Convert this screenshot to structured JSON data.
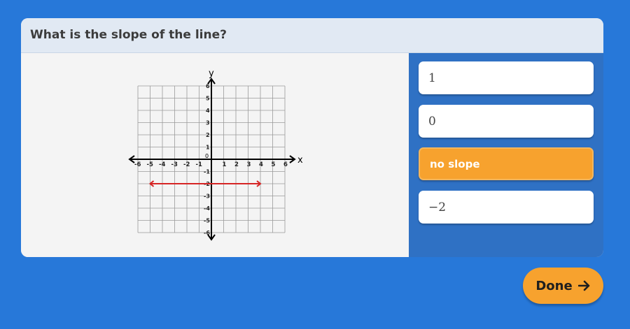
{
  "question": "What is the slope of the line?",
  "graph": {
    "axis_x_label": "x",
    "axis_y_label": "y",
    "origin_label": "0",
    "x_ticks": [
      "-6",
      "-5",
      "-4",
      "-3",
      "-2",
      "-1",
      "1",
      "2",
      "3",
      "4",
      "5",
      "6"
    ],
    "y_ticks": [
      "6",
      "5",
      "4",
      "3",
      "2",
      "1",
      "-1",
      "-2",
      "-3",
      "-4",
      "-5",
      "-6"
    ],
    "line_color": "#d62424",
    "line": {
      "x_from": -5,
      "x_to": 4,
      "y": -2
    }
  },
  "choices": [
    {
      "label": "1",
      "selected": false
    },
    {
      "label": "0",
      "selected": false
    },
    {
      "label": "no slope",
      "selected": true
    },
    {
      "label": "−2",
      "selected": false
    }
  ],
  "done_button": {
    "label": "Done",
    "icon": "arrow-right-icon"
  },
  "colors": {
    "background": "#2778d9",
    "accent": "#f7a22e",
    "panel": "#2f71c4"
  }
}
